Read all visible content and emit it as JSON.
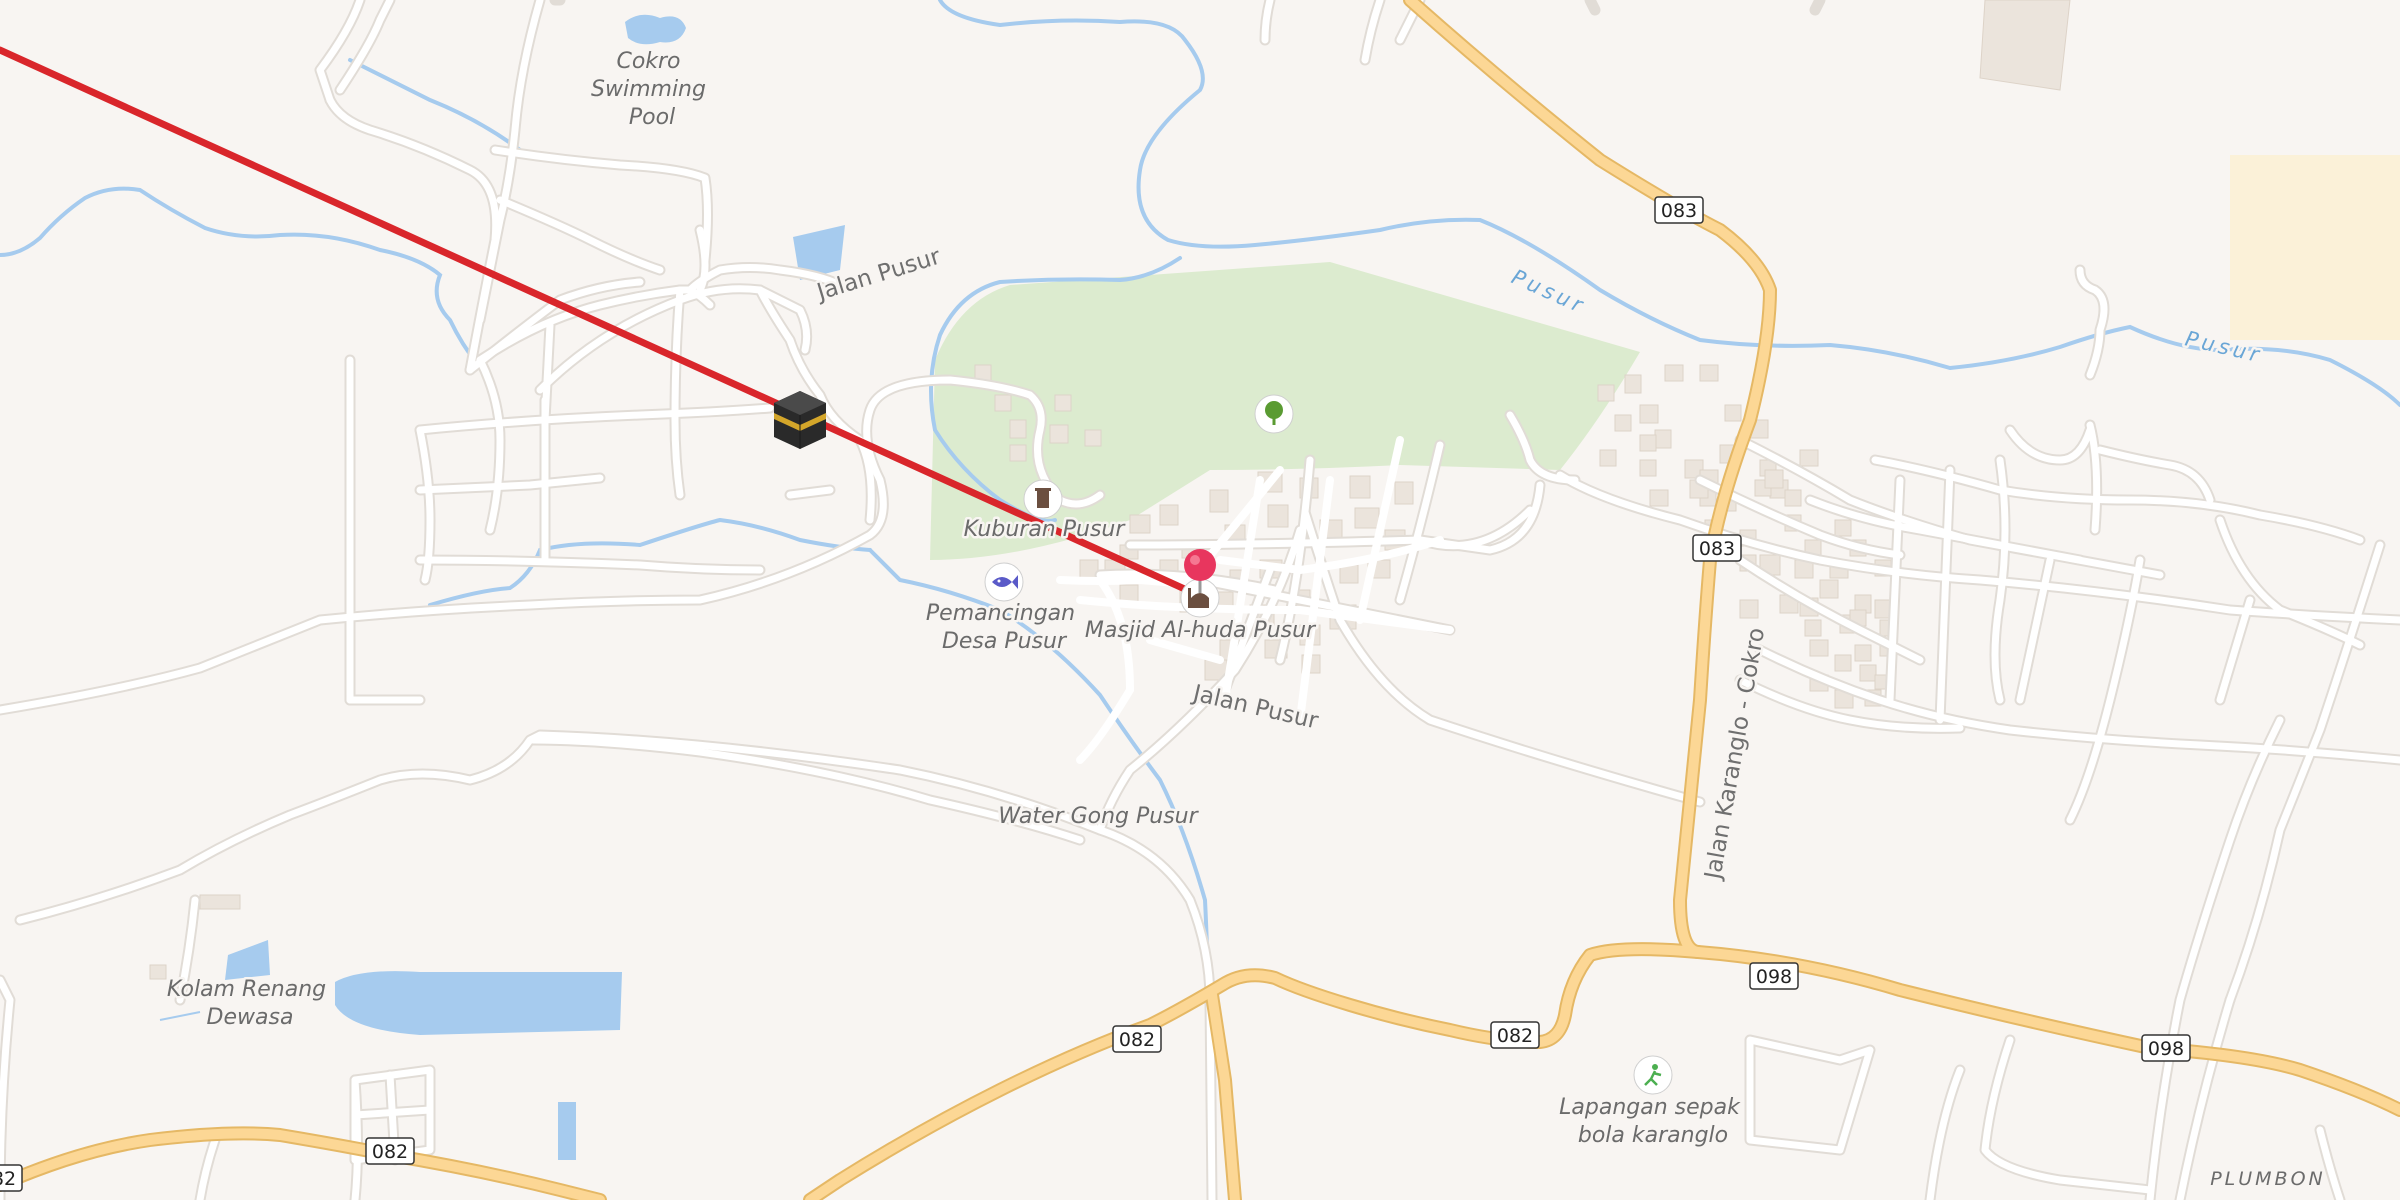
{
  "map": {
    "qibla_line_color": "#d9262b",
    "water_color": "#a6cbee",
    "park_color": "#dcebcf",
    "major_road_color": "#f7d28a",
    "minor_road_color": "#ffffff",
    "background_color": "#f8f5f2"
  },
  "pois": {
    "swimming_pool": "Cokro\nSwimming\nPool",
    "cemetery": "Kuburan Pusur",
    "fishing": "Pemancingan\nDesa Pusur",
    "mosque": "Masjid Al-huda Pusur",
    "water_gong": "Water Gong Pusur",
    "kolam": "Kolam Renang\nDewasa",
    "football": "Lapangan sepak\nbola karanglo",
    "place": "PLUMBON"
  },
  "roads": {
    "jalan_pusur_north": "Jalan Pusur",
    "jalan_pusur_south": "Jalan Pusur",
    "jalan_karanglo": "Jalan Karanglo - Cokro"
  },
  "rivers": {
    "pusur_1": "Pusur",
    "pusur_2": "Pusur"
  },
  "shields": [
    "083",
    "083",
    "098",
    "098",
    "082",
    "082",
    "082",
    "82"
  ],
  "icons": {
    "kaaba": "kaaba-icon",
    "location_pin": "location-pin-icon",
    "park_tree": "tree-icon",
    "cemetery": "cemetery-icon",
    "fishing": "fish-icon",
    "mosque": "mosque-icon",
    "football": "football-icon"
  }
}
